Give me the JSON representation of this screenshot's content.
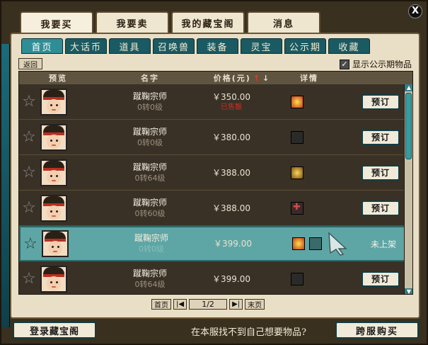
{
  "window": {
    "close_label": "X"
  },
  "top_tabs": [
    {
      "label": "我要买",
      "active": true
    },
    {
      "label": "我要卖",
      "active": false
    },
    {
      "label": "我的藏宝阁",
      "active": false
    },
    {
      "label": "消息",
      "active": false
    }
  ],
  "sub_tabs": [
    {
      "label": "首页",
      "active": true
    },
    {
      "label": "大话币",
      "active": false
    },
    {
      "label": "道具",
      "active": false
    },
    {
      "label": "召唤兽",
      "active": false
    },
    {
      "label": "装备",
      "active": false
    },
    {
      "label": "灵宝",
      "active": false
    },
    {
      "label": "公示期",
      "active": false
    },
    {
      "label": "收藏",
      "active": false
    }
  ],
  "toolbar": {
    "back_label": "返回",
    "show_public_label": "显示公示期物品",
    "show_public_checked": true
  },
  "table": {
    "headers": {
      "preview": "预览",
      "name": "名字",
      "price": "价格(元)",
      "sort_up": "↑",
      "sort_down": "↓",
      "detail": "详情"
    },
    "rows": [
      {
        "name": "蹴鞠宗师",
        "level": "0转0级",
        "price": "￥350.00",
        "status": "已售罄",
        "icons": [
          "fire"
        ],
        "action": "预订"
      },
      {
        "name": "蹴鞠宗师",
        "level": "0转0级",
        "price": "￥380.00",
        "status": "",
        "icons": [
          "dark"
        ],
        "action": "预订"
      },
      {
        "name": "蹴鞠宗师",
        "level": "0转64级",
        "price": "￥388.00",
        "status": "",
        "icons": [
          "gold"
        ],
        "action": "预订"
      },
      {
        "name": "蹴鞠宗师",
        "level": "0转60级",
        "price": "￥388.00",
        "status": "",
        "icons": [
          "cross"
        ],
        "action": "预订"
      },
      {
        "name": "蹴鞠宗师",
        "level": "0转0级",
        "price": "￥399.00",
        "status": "",
        "icons": [
          "fire",
          "teal"
        ],
        "action": "未上架",
        "highlight": true
      },
      {
        "name": "蹴鞠宗师",
        "level": "0转64级",
        "price": "￥399.00",
        "status": "",
        "icons": [
          "dark"
        ],
        "action": "预订"
      }
    ]
  },
  "pager": {
    "first_label": "首页",
    "prev_label": "|◀",
    "page_text": "1/2",
    "next_label": "▶|",
    "last_label": "末页"
  },
  "footer": {
    "login_label": "登录藏宝阁",
    "notice": "在本服找不到自己想要物品?",
    "cross_server_label": "跨服购买"
  }
}
